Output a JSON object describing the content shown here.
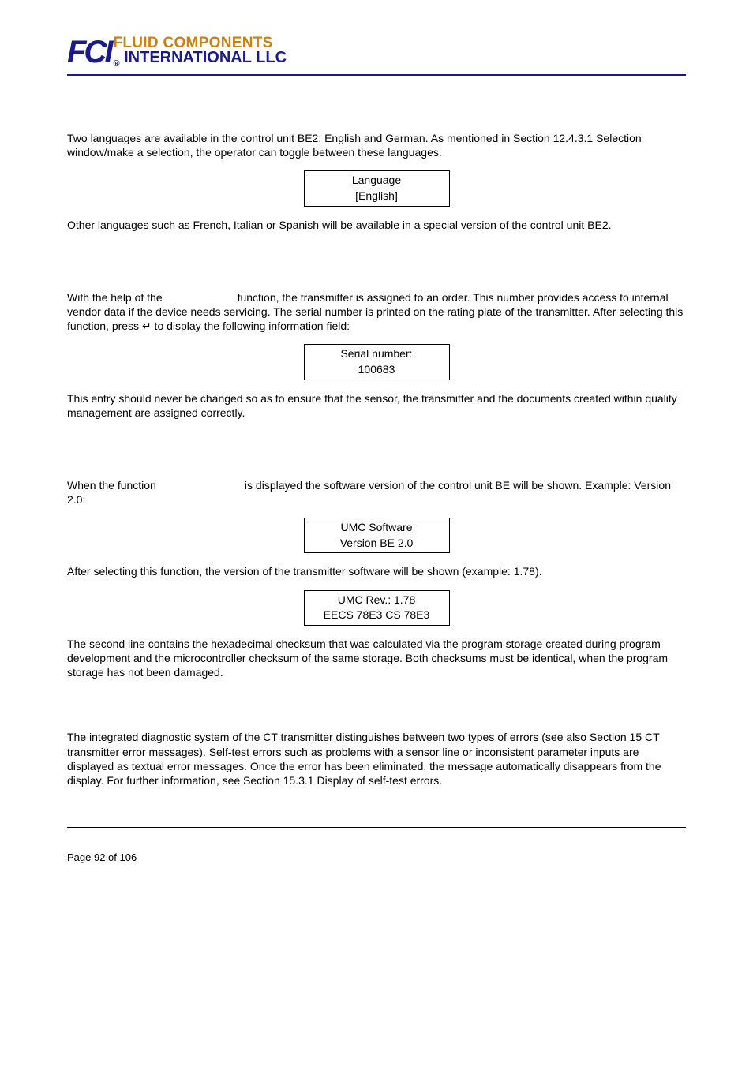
{
  "logo": {
    "fci": "FCI",
    "line1": "FLUID COMPONENTS",
    "line2": "INTERNATIONAL LLC"
  },
  "sections": {
    "s1": {
      "p1": "Two languages are available in the control unit BE2: English and German. As mentioned in Section 12.4.3.1 Selection window/make a selection, the operator can toggle between these languages.",
      "box": {
        "l1": "Language",
        "l2": "[English]"
      },
      "p2": "Other languages such as French, Italian or Spanish will be available in a special version of the control unit BE2."
    },
    "s2": {
      "p1a": "With the help of the ",
      "p1b": " function, the transmitter is assigned to an order. This number provides access to internal vendor data if the device needs servicing. The serial number is printed on the rating plate of the transmitter. After selecting this function, press ↵ to display the following information field:",
      "box": {
        "l1": "Serial number:",
        "l2": "100683"
      },
      "p2": "This entry should never be changed so as to ensure that the sensor, the transmitter and the documents created within quality management are assigned correctly."
    },
    "s3": {
      "p1a": "When the function ",
      "p1b": " is displayed  the software version of the control unit BE will be shown. Example: Version 2.0:",
      "box1": {
        "l1": "UMC Software",
        "l2": "Version BE 2.0"
      },
      "p2": "After selecting this function, the version of the transmitter software will be shown (example: 1.78).",
      "box2": {
        "l1": "UMC Rev.: 1.78",
        "l2": "EECS 78E3   CS 78E3"
      },
      "p3": "The second line contains the hexadecimal checksum that was calculated via the program storage created during program development and the microcontroller checksum of the same storage. Both checksums must be identical, when the program storage has not been damaged."
    },
    "s4": {
      "p1": "The integrated diagnostic system of the CT transmitter distinguishes between two types of errors (see also Section 15 CT transmitter error messages). Self-test errors such as problems with a sensor line or inconsistent parameter inputs are displayed as textual error messages. Once the error has been eliminated, the message automatically disappears from the display. For further information, see Section 15.3.1 Display of self-test errors."
    }
  },
  "footer": {
    "page": "Page 92 of 106"
  }
}
